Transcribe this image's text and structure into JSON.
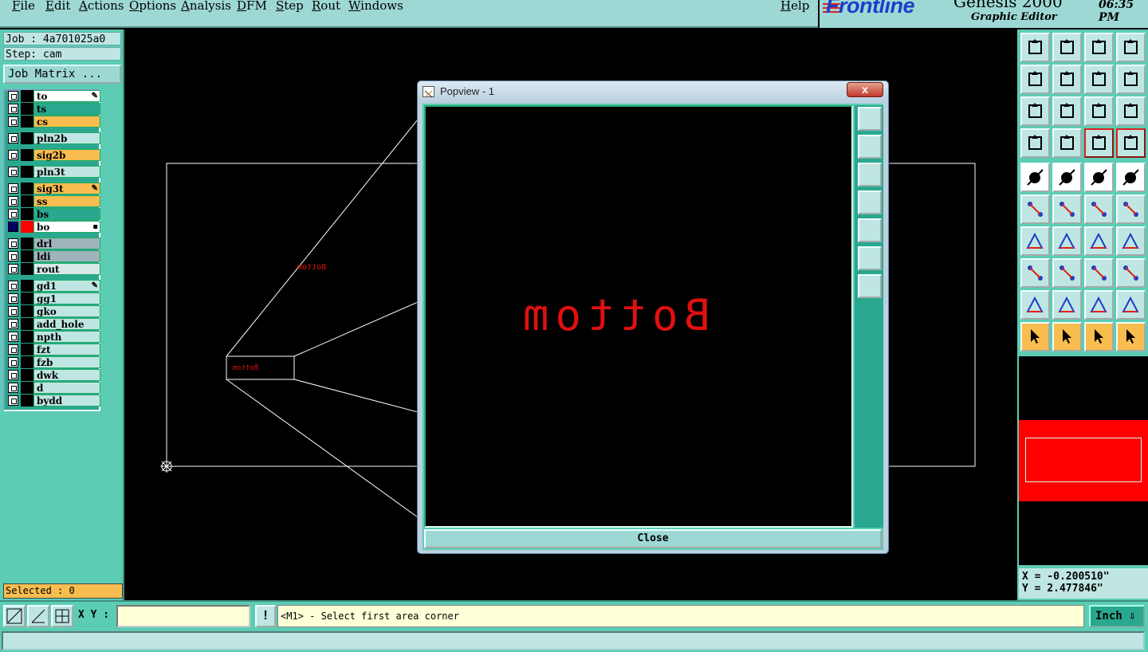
{
  "menu": {
    "items": [
      "File",
      "Edit",
      "Actions",
      "Options",
      "Analysis",
      "DFM",
      "Step",
      "Rout",
      "Windows"
    ],
    "help": "Help"
  },
  "branding": {
    "logo": "Frontline",
    "product": "Genesis 2000",
    "subtitle": "Graphic Editor",
    "clock": "06:35 PM"
  },
  "job": {
    "job_line": "Job : 4a701025a0",
    "step_line": "Step: cam",
    "matrix_button": "Job Matrix ..."
  },
  "layers": [
    {
      "name": "to",
      "bg": "#ffffff",
      "mark": "✎"
    },
    {
      "name": "ts",
      "bg": "#2aa88f",
      "mark": ""
    },
    {
      "name": "cs",
      "bg": "#f7bd4f",
      "mark": ""
    },
    {
      "name": "pln2b",
      "bg": "#bfe6e2",
      "mark": ""
    },
    {
      "name": "sig2b",
      "bg": "#f7bd4f",
      "mark": ""
    },
    {
      "name": "pln3t",
      "bg": "#bfe6e2",
      "mark": ""
    },
    {
      "name": "sig3t",
      "bg": "#f7bd4f",
      "mark": "✎"
    },
    {
      "name": "ss",
      "bg": "#f7bd4f",
      "mark": ""
    },
    {
      "name": "bs",
      "bg": "#2aa88f",
      "mark": ""
    },
    {
      "name": "bo",
      "bg": "#ffffff",
      "mark": "▪",
      "color": "#ff0000",
      "boxbg": "#000080"
    },
    {
      "name": "drl",
      "bg": "#9fb3bb",
      "mark": ""
    },
    {
      "name": "ldi",
      "bg": "#9fb3bb",
      "mark": ""
    },
    {
      "name": "rout",
      "bg": "#d8e8e8",
      "mark": ""
    },
    {
      "name": "gd1",
      "bg": "#bfe6e2",
      "mark": "✎"
    },
    {
      "name": "gg1",
      "bg": "#bfe6e2",
      "mark": ""
    },
    {
      "name": "gko",
      "bg": "#bfe6e2",
      "mark": ""
    },
    {
      "name": "add_hole",
      "bg": "#bfe6e2",
      "mark": ""
    },
    {
      "name": "npth",
      "bg": "#bfe6e2",
      "mark": ""
    },
    {
      "name": "fzt",
      "bg": "#bfe6e2",
      "mark": ""
    },
    {
      "name": "fzb",
      "bg": "#bfe6e2",
      "mark": ""
    },
    {
      "name": "dwk",
      "bg": "#bfe6e2",
      "mark": ""
    },
    {
      "name": "d",
      "bg": "#bfe6e2",
      "mark": ""
    },
    {
      "name": "bydd",
      "bg": "#bfe6e2",
      "mark": ""
    }
  ],
  "selected": "Selected : 0",
  "popview": {
    "title": "Popview - 1",
    "close_x": "x",
    "close_button": "Close",
    "text_mirrored": "Bottom"
  },
  "canvas": {
    "small_label": "Bottom",
    "inner_label": "Bottom"
  },
  "coords": {
    "x": "X = -0.200510\"",
    "y": "Y = 2.477846\""
  },
  "cmd": {
    "xy_label": "X Y :",
    "xy_value": "",
    "warn": "!",
    "prompt": "<M1> - Select first area corner",
    "units": "Inch ⇩"
  },
  "status": ""
}
